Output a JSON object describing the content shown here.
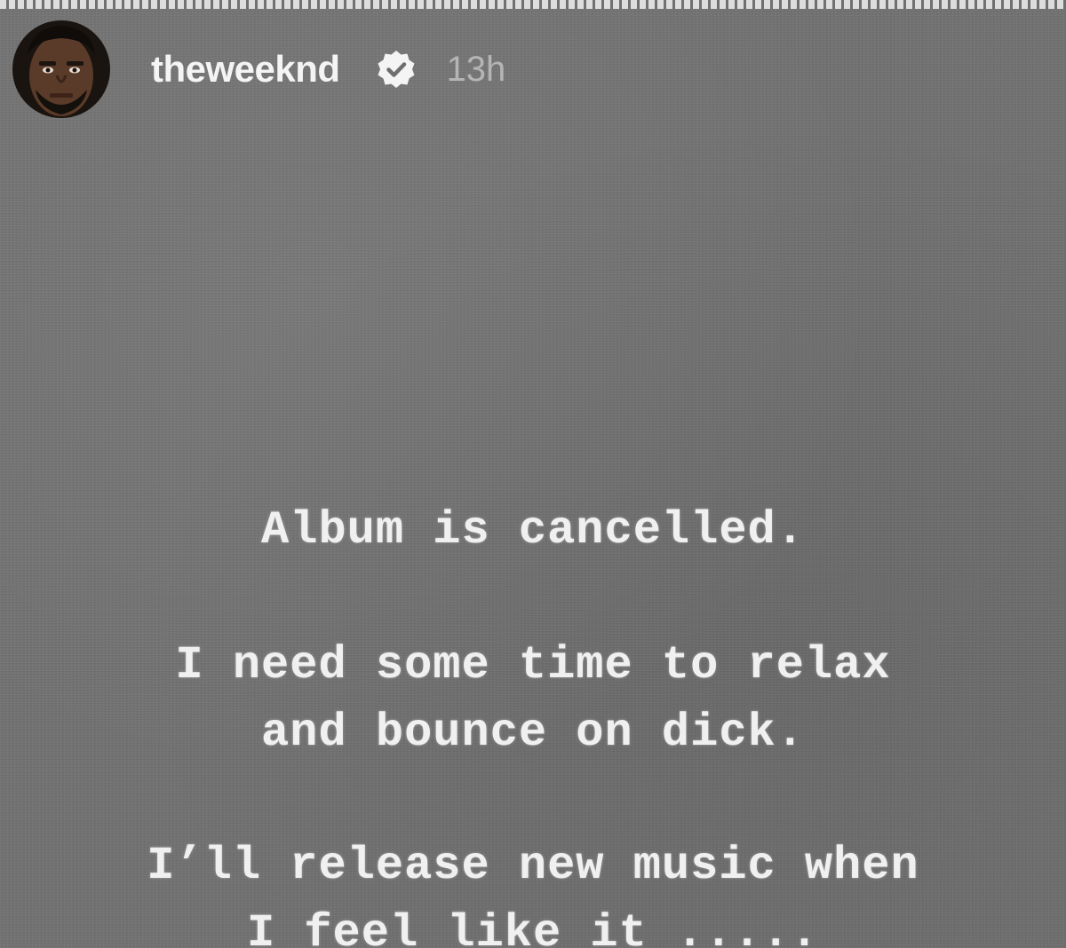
{
  "story": {
    "username": "theweeknd",
    "time_ago": "13h",
    "verified_icon": "verified-badge-icon",
    "text_lines": [
      "Album is cancelled.",
      "I need some time to relax",
      "and bounce on dick.",
      "I’ll release new music when",
      "I feel like it ....."
    ]
  },
  "colors": {
    "background": "#727272",
    "text": "#f0f0f0",
    "timestamp": "#b5b5b5"
  }
}
